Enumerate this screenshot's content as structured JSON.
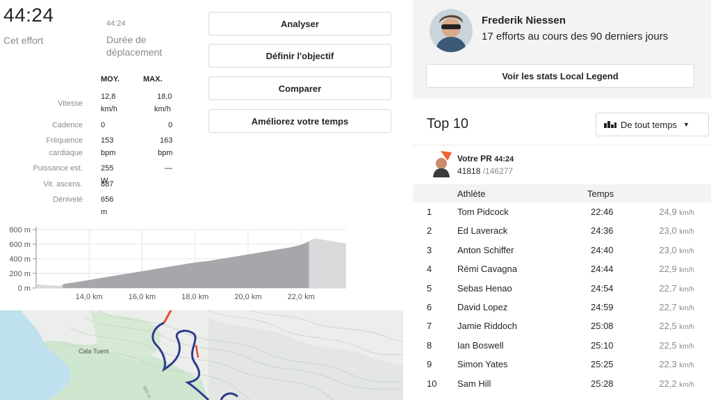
{
  "effort": {
    "time": "44:24",
    "time_label": "Cet effort",
    "moving_time": "44:24",
    "moving_label": "Durée de déplacement"
  },
  "stats": {
    "col_avg": "MOY.",
    "col_max": "MAX.",
    "speed_label": "Vitesse",
    "speed_avg": "12,8",
    "speed_avg_unit": "km/h",
    "speed_max": "18,0",
    "speed_max_unit": "km/h",
    "cadence_label": "Cadence",
    "cadence_avg": "0",
    "cadence_max": "0",
    "hr_label_1": "Fréquence",
    "hr_label_2": "cardiaque",
    "hr_avg": "153",
    "hr_avg_unit": "bpm",
    "hr_max": "163",
    "hr_max_unit": "bpm",
    "power_label": "Puissance est.",
    "power_avg": "255 W",
    "power_max": "—",
    "vam_label": "Vit. ascens.",
    "vam_avg": "887",
    "elev_label": "Dénivelé",
    "elev_avg": "656 m"
  },
  "buttons": {
    "analyze": "Analyser",
    "goal": "Définir l'objectif",
    "compare": "Comparer",
    "improve": "Améliorez votre temps"
  },
  "chart_data": {
    "type": "area",
    "xlabel": "",
    "ylabel": "",
    "y_ticks": [
      "800 m",
      "600 m",
      "400 m",
      "200 m",
      "0 m"
    ],
    "x_ticks": [
      "14,0 km",
      "16,0 km",
      "18,0 km",
      "20,0 km",
      "22,0 km"
    ],
    "ylim": [
      0,
      800
    ],
    "xlim": [
      12.0,
      23.7
    ],
    "x": [
      12.0,
      12.4,
      12.9,
      13.1,
      13.5,
      14.0,
      14.5,
      15.0,
      15.5,
      16.0,
      16.5,
      17.0,
      17.5,
      18.0,
      18.5,
      19.0,
      19.5,
      20.0,
      20.5,
      21.0,
      21.5,
      22.0,
      22.3,
      22.5,
      23.0,
      23.7
    ],
    "y": [
      50,
      40,
      30,
      60,
      80,
      110,
      140,
      170,
      200,
      230,
      260,
      290,
      320,
      350,
      370,
      400,
      430,
      460,
      490,
      520,
      550,
      590,
      640,
      680,
      650,
      610
    ],
    "segment_start_km": 13.0,
    "segment_end_km": 22.3,
    "grid": true
  },
  "map": {
    "place_label": "Cala Tuent",
    "contour_label": "600 m",
    "route_color": "#2d3a8c",
    "accent_color": "#e34a2f"
  },
  "local_legend": {
    "name": "Frederik Niessen",
    "subtitle": "17 efforts au cours des 90 derniers jours",
    "button": "Voir les stats Local Legend"
  },
  "leaderboard": {
    "title": "Top 10",
    "filter": "De tout temps",
    "pr_label": "Votre PR",
    "pr_time": "44:24",
    "pr_rank": "41818",
    "pr_total": "/146277",
    "col_athlete": "Athlète",
    "col_time": "Temps",
    "rows": [
      {
        "rank": "1",
        "name": "Tom Pidcock",
        "time": "22:46",
        "speed": "24,9",
        "unit": "km/h"
      },
      {
        "rank": "2",
        "name": "Ed Laverack",
        "time": "24:36",
        "speed": "23,0",
        "unit": "km/h"
      },
      {
        "rank": "3",
        "name": "Anton Schiffer",
        "time": "24:40",
        "speed": "23,0",
        "unit": "km/h"
      },
      {
        "rank": "4",
        "name": "Rémi Cavagna",
        "time": "24:44",
        "speed": "22,9",
        "unit": "km/h"
      },
      {
        "rank": "5",
        "name": "Sebas Henao",
        "time": "24:54",
        "speed": "22,7",
        "unit": "km/h"
      },
      {
        "rank": "6",
        "name": "David Lopez",
        "time": "24:59",
        "speed": "22,7",
        "unit": "km/h"
      },
      {
        "rank": "7",
        "name": "Jamie Riddoch",
        "time": "25:08",
        "speed": "22,5",
        "unit": "km/h"
      },
      {
        "rank": "8",
        "name": "Ian Boswell",
        "time": "25:10",
        "speed": "22,5",
        "unit": "km/h"
      },
      {
        "rank": "9",
        "name": "Simon Yates",
        "time": "25:25",
        "speed": "22,3",
        "unit": "km/h"
      },
      {
        "rank": "10",
        "name": "Sam Hill",
        "time": "25:28",
        "speed": "22,2",
        "unit": "km/h"
      }
    ]
  }
}
